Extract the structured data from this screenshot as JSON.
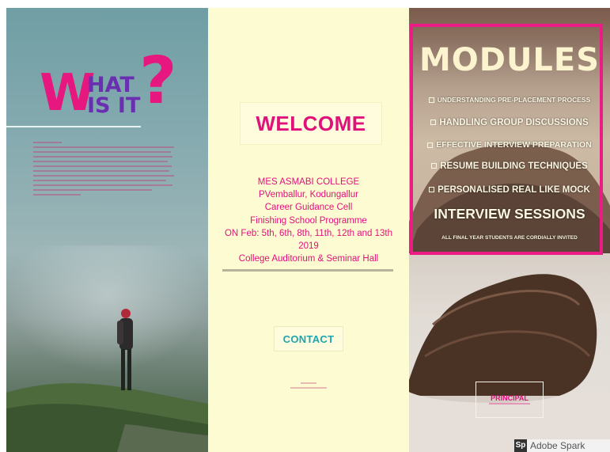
{
  "left": {
    "title_w": "W",
    "title_hat": "HAT",
    "title_isit": "IS IT",
    "title_q": "?"
  },
  "middle": {
    "welcome": "WELCOME",
    "info_lines": [
      "MES ASMABI COLLEGE",
      "PVemballur, Kodungallur",
      "Career Guidance Cell",
      "Finishing School Programme",
      "ON Feb: 5th, 6th, 8th, 11th, 12th and 13th",
      "2019",
      "College Auditorium & Seminar Hall"
    ],
    "contact": "CONTACT"
  },
  "right": {
    "title": "MODULES",
    "items": [
      "UNDERSTANDING PRE-PLACEMENT PROCESS",
      "HANDLING GROUP DISCUSSIONS",
      "EFFECTIVE INTERVIEW PREPARATION",
      "RESUME BUILDING TECHNIQUES",
      "PERSONALISED REAL LIKE MOCK",
      "INTERVIEW SESSIONS",
      "ALL FINAL YEAR STUDENTS ARE CORDIALLY INVITED"
    ],
    "principal": "PRINCIPAL"
  },
  "watermark": {
    "logo": "Sp",
    "text": "Adobe Spark"
  },
  "colors": {
    "accent_pink": "#e6177f",
    "accent_purple": "#6a2fb0",
    "contact_teal": "#1ba6b0",
    "cream": "#fdfbd1"
  }
}
